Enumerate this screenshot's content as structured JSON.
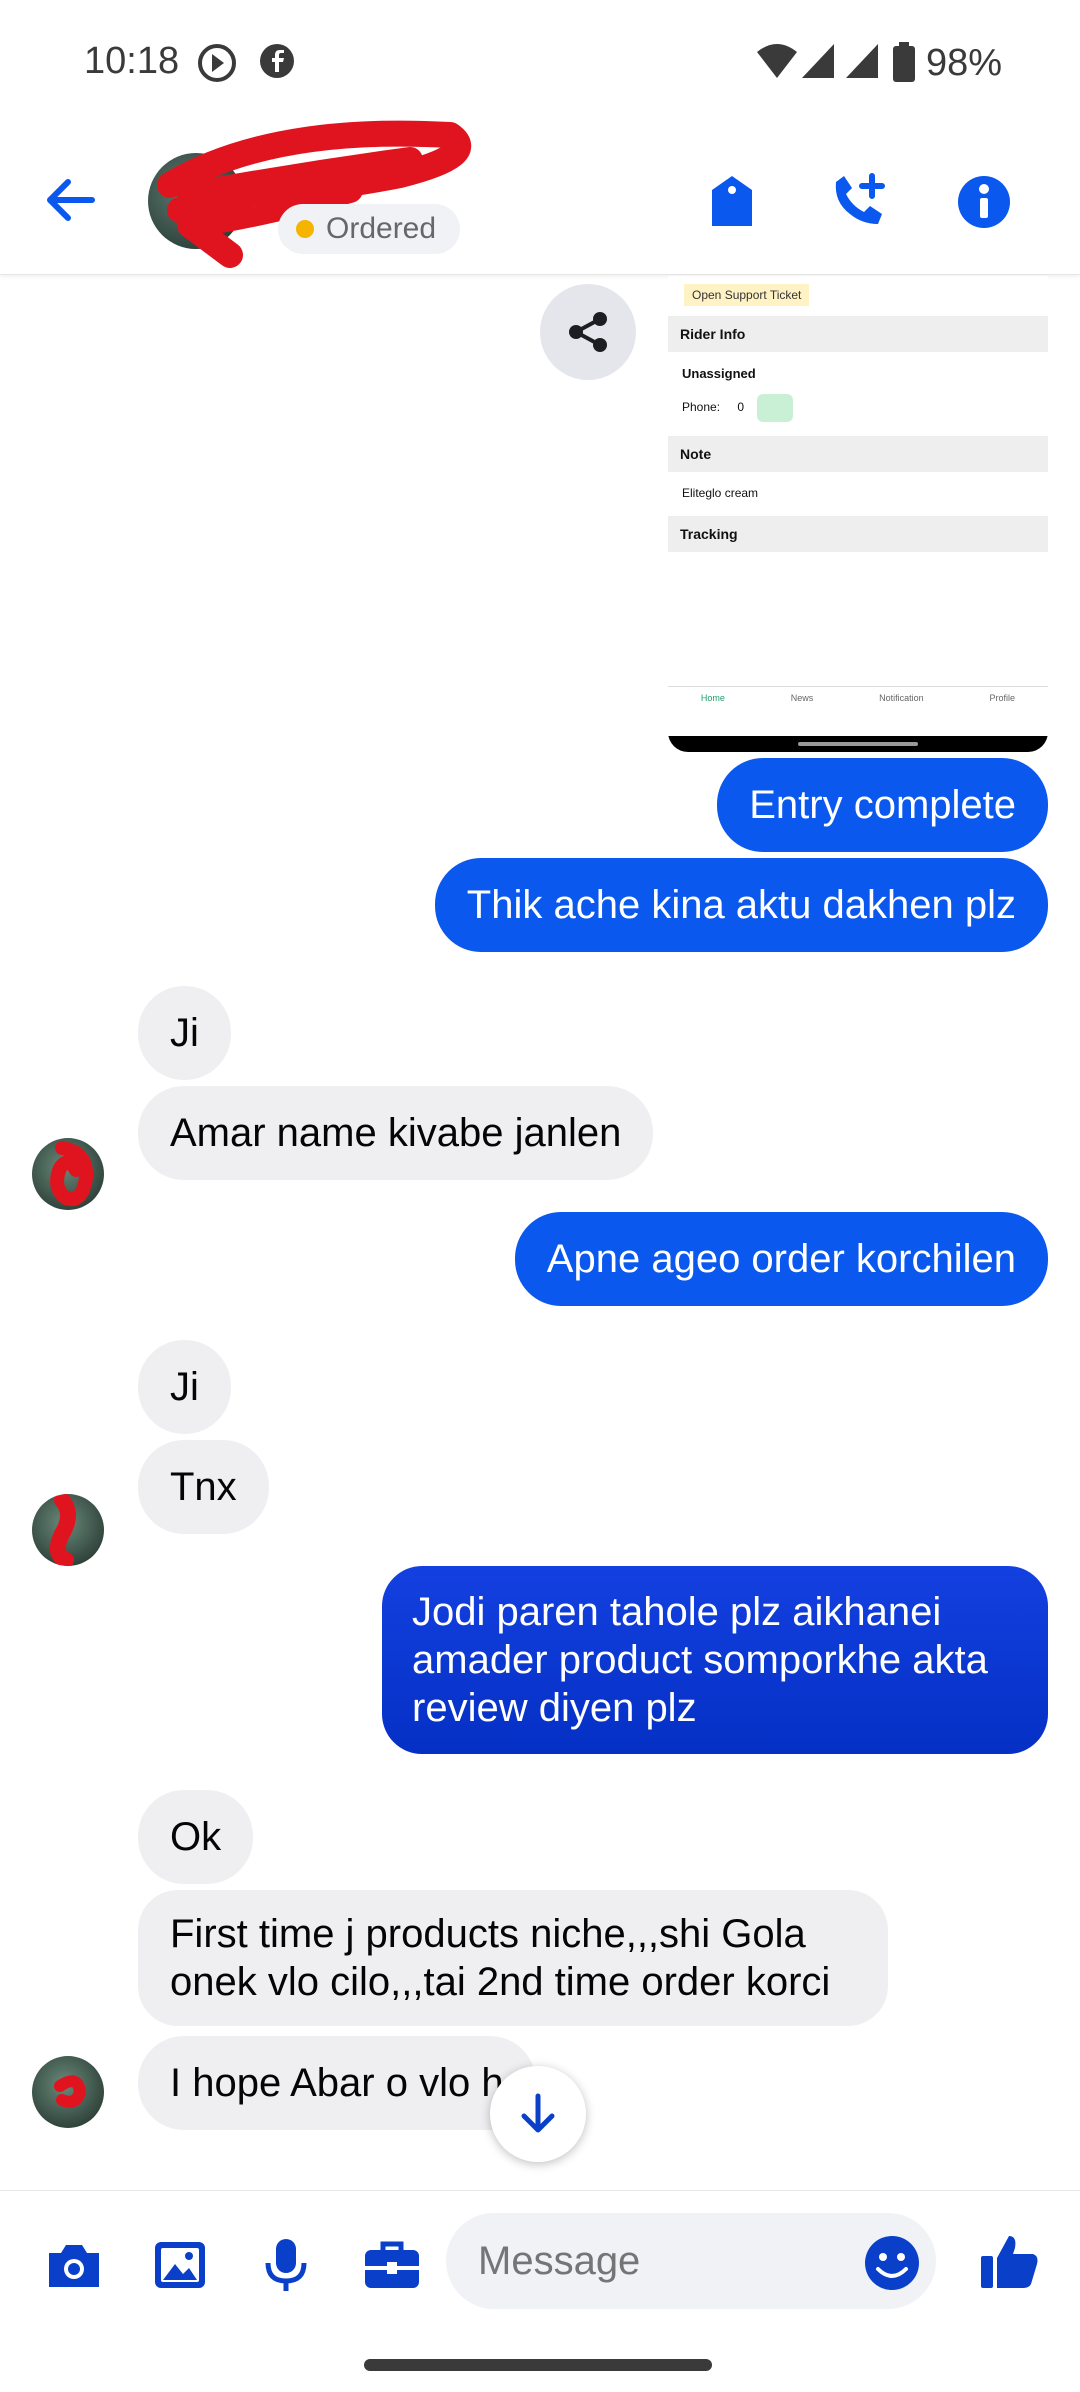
{
  "status_bar": {
    "time": "10:18",
    "battery": "98%",
    "icons": [
      "media-icon",
      "facebook-icon",
      "wifi-icon",
      "signal-icon",
      "battery-icon"
    ]
  },
  "header": {
    "status_label": "Ordered",
    "actions": [
      "back-arrow-icon",
      "tag-icon",
      "add-call-icon",
      "info-icon"
    ],
    "accent": "#0a58ed"
  },
  "shared_screenshot": {
    "ticket_label": "Open Support Ticket",
    "rider_info": "Rider Info",
    "rider_status": "Unassigned",
    "phone_label": "Phone:",
    "phone_value": "0",
    "note_header": "Note",
    "note_value": "Eliteglo cream",
    "tracking_header": "Tracking",
    "nav": [
      "Home",
      "News",
      "Notification",
      "Profile"
    ]
  },
  "messages": [
    {
      "from": "me",
      "text": "Entry complete"
    },
    {
      "from": "me",
      "text": "Thik ache kina aktu dakhen plz"
    },
    {
      "from": "them",
      "text": "Ji"
    },
    {
      "from": "them",
      "text": "Amar name kivabe janlen"
    },
    {
      "from": "me",
      "text": "Apne ageo order korchilen"
    },
    {
      "from": "them",
      "text": "Ji"
    },
    {
      "from": "them",
      "text": "Tnx"
    },
    {
      "from": "me",
      "text": "Jodi paren tahole plz aikhanei amader product somporkhe akta review diyen plz"
    },
    {
      "from": "them",
      "text": "Ok"
    },
    {
      "from": "them",
      "text": "First time j products niche,,,shi Gola onek vlo cilo,,,tai 2nd time order korci"
    },
    {
      "from": "them",
      "text": "I hope Abar o vlo h"
    }
  ],
  "composer": {
    "placeholder": "Message",
    "buttons": [
      "camera-icon",
      "gallery-icon",
      "mic-icon",
      "briefcase-icon",
      "emoji-icon",
      "like-icon"
    ]
  }
}
